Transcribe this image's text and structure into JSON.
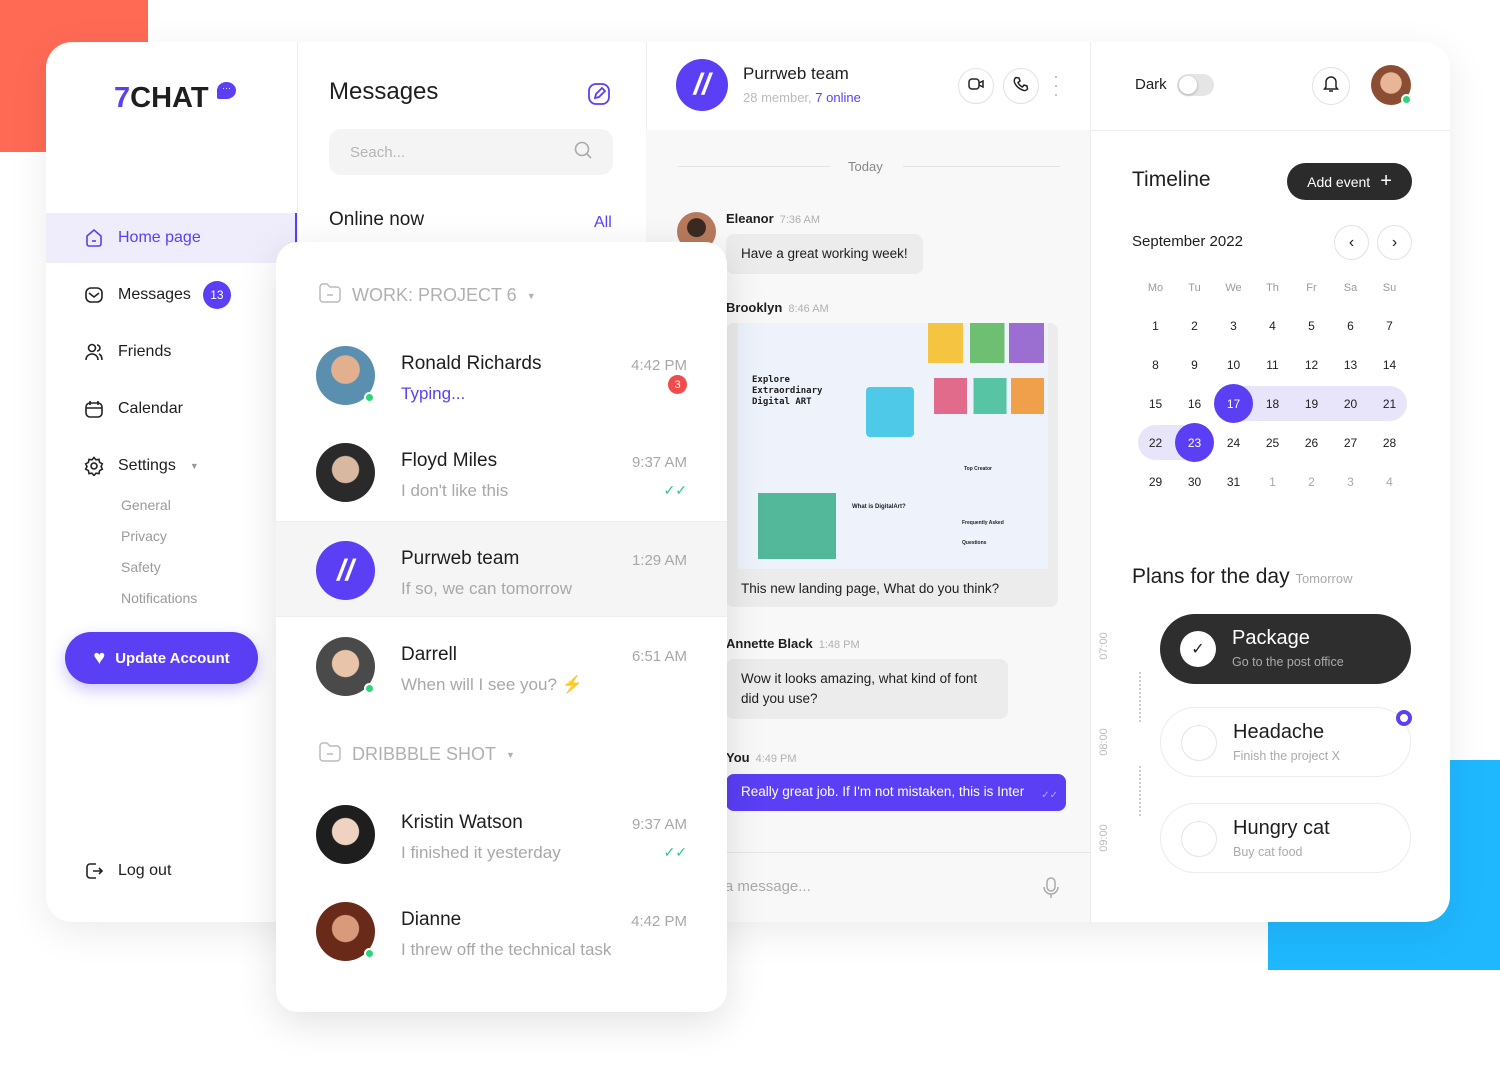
{
  "brand": {
    "logo_accent": "7",
    "logo_text": "CHAT",
    "accent_color": "#5a3ff5"
  },
  "sidebar": {
    "items": [
      {
        "label": "Home page",
        "icon": "home-icon",
        "active": true
      },
      {
        "label": "Messages",
        "icon": "message-icon",
        "badge": "13"
      },
      {
        "label": "Friends",
        "icon": "users-icon"
      },
      {
        "label": "Calendar",
        "icon": "calendar-icon"
      },
      {
        "label": "Settings",
        "icon": "gear-icon"
      }
    ],
    "settings_sub": [
      "General",
      "Privacy",
      "Safety",
      "Notifications"
    ],
    "update_button": "Update Account",
    "logout": "Log out"
  },
  "messages": {
    "title": "Messages",
    "search_placeholder": "Seach...",
    "online_now": "Online now",
    "all_link": "All",
    "folders": [
      {
        "name": "WORK: PROJECT 6",
        "chats": [
          {
            "name": "Ronald Richards",
            "msg": "Typing...",
            "time": "4:42 PM",
            "unread": "3",
            "online": true
          },
          {
            "name": "Floyd Miles",
            "msg": "I don't like this",
            "time": "9:37 AM",
            "read": true
          },
          {
            "name": "Purrweb team",
            "msg": "If so, we can tomorrow",
            "time": "1:29 AM",
            "selected": true
          },
          {
            "name": "Darrell",
            "msg": "When will I see you? ⚡",
            "time": "6:51 AM",
            "online": true
          }
        ]
      },
      {
        "name": "DRIBBBLE SHOT",
        "chats": [
          {
            "name": "Kristin Watson",
            "msg": "I finished it yesterday",
            "time": "9:37 AM",
            "read": true
          },
          {
            "name": "Dianne",
            "msg": "I threw off the technical task",
            "time": "4:42 PM",
            "online": true
          }
        ]
      }
    ]
  },
  "chat": {
    "title": "Purrweb team",
    "members": "28 member,",
    "online": "7 online",
    "day_label": "Today",
    "messages": [
      {
        "sender": "Eleanor",
        "time": "7:36 AM",
        "text": "Have a great working week!"
      },
      {
        "sender": "Brooklyn",
        "time": "8:46 AM",
        "text": "This new landing page, What do you think?",
        "image": {
          "headline": "Explore Extraordinary Digital ART",
          "section1": "What is DigitalArt?",
          "section2": "Top Creator",
          "section3": "Frequently Asked Questions"
        }
      },
      {
        "sender": "Annette Black",
        "time": "1:48 PM",
        "text": "Wow it looks amazing, what kind of font did you use?"
      },
      {
        "sender": "You",
        "time": "4:49 PM",
        "text": "Really great job. If I'm not mistaken, this is Inter"
      }
    ],
    "input_placeholder": "Write a message..."
  },
  "right": {
    "dark_label": "Dark",
    "dark_on": false,
    "timeline": "Timeline",
    "add_event": "Add event",
    "month": "September 2022",
    "weekdays": [
      "Mo",
      "Tu",
      "We",
      "Th",
      "Fr",
      "Sa",
      "Su"
    ],
    "weeks": [
      [
        "1",
        "2",
        "3",
        "4",
        "5",
        "6",
        "7"
      ],
      [
        "8",
        "9",
        "10",
        "11",
        "12",
        "13",
        "14"
      ],
      [
        "15",
        "16",
        "17",
        "18",
        "19",
        "20",
        "21"
      ],
      [
        "22",
        "23",
        "24",
        "25",
        "26",
        "27",
        "28"
      ],
      [
        "29",
        "30",
        "31",
        "1",
        "2",
        "3",
        "4"
      ]
    ],
    "selected_days": [
      "17",
      "23"
    ],
    "plans_title": "Plans for the day",
    "plans_sub": "Tomorrow",
    "times": [
      "07:00",
      "08:00",
      "09:00"
    ],
    "plans": [
      {
        "title": "Package",
        "sub": "Go to the post office",
        "done": true
      },
      {
        "title": "Headache",
        "sub": "Finish the project X",
        "done": false
      },
      {
        "title": "Hungry cat",
        "sub": "Buy cat food",
        "done": false
      }
    ]
  }
}
